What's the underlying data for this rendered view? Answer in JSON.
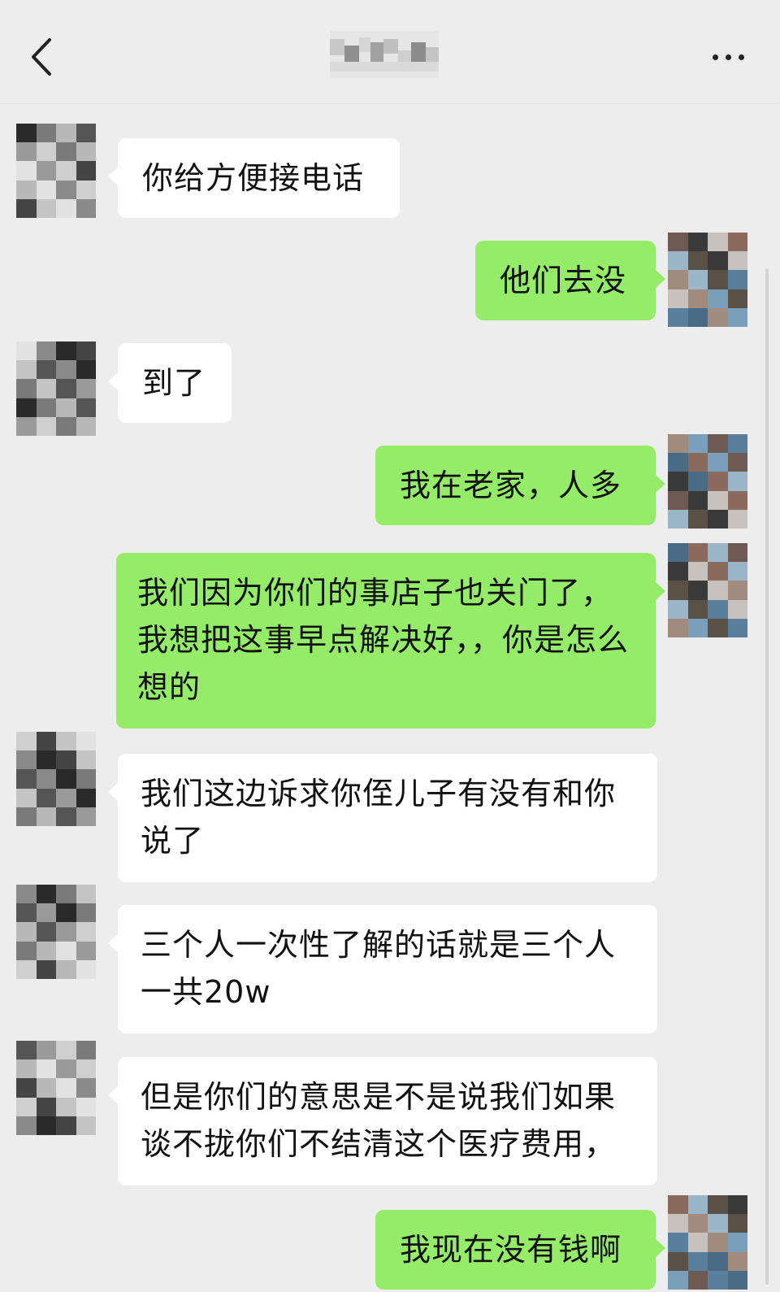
{
  "header": {
    "back_icon": "chevron-left-icon",
    "title": "",
    "more_icon": "more-horizontal-icon"
  },
  "colors": {
    "background": "#ededed",
    "incoming_bubble": "#ffffff",
    "outgoing_bubble": "#95ec69"
  },
  "messages": [
    {
      "side": "incoming",
      "text": "你给方便接电话"
    },
    {
      "side": "outgoing",
      "text": "他们去没"
    },
    {
      "side": "incoming",
      "text": "到了"
    },
    {
      "side": "outgoing",
      "text": "我在老家，人多"
    },
    {
      "side": "outgoing",
      "text": "我们因为你们的事店子也关门了，我想把这事早点解决好，，你是怎么想的"
    },
    {
      "side": "incoming",
      "text": "我们这边诉求你侄儿子有没有和你说了"
    },
    {
      "side": "incoming",
      "text": "三个人一次性了解的话就是三个人一共20w"
    },
    {
      "side": "incoming",
      "text": "但是你们的意思是不是说我们如果谈不拢你们不结清这个医疗费用，"
    },
    {
      "side": "outgoing",
      "text": "我现在没有钱啊"
    }
  ]
}
